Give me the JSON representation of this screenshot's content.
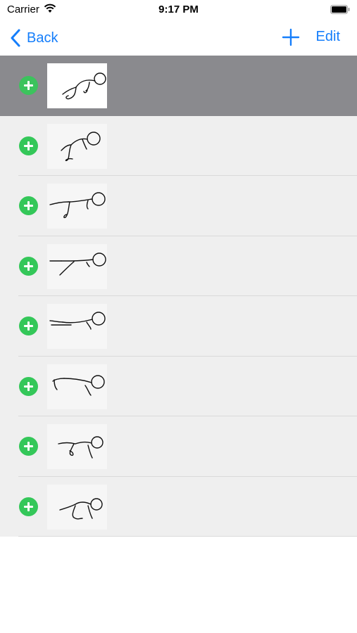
{
  "status": {
    "carrier": "Carrier",
    "time": "9:17 PM"
  },
  "nav": {
    "back_label": "Back",
    "edit_label": "Edit"
  },
  "rows": [
    {
      "selected": true,
      "icon": "stick-figure-pose-1"
    },
    {
      "selected": false,
      "icon": "stick-figure-pose-2"
    },
    {
      "selected": false,
      "icon": "stick-figure-pose-3"
    },
    {
      "selected": false,
      "icon": "stick-figure-pose-4"
    },
    {
      "selected": false,
      "icon": "stick-figure-pose-5"
    },
    {
      "selected": false,
      "icon": "stick-figure-pose-6"
    },
    {
      "selected": false,
      "icon": "stick-figure-pose-7"
    },
    {
      "selected": false,
      "icon": "stick-figure-pose-8"
    }
  ],
  "colors": {
    "accent": "#157efb",
    "add": "#34c759",
    "selected_row": "#8a8a8e",
    "list_bg": "#efefef"
  }
}
